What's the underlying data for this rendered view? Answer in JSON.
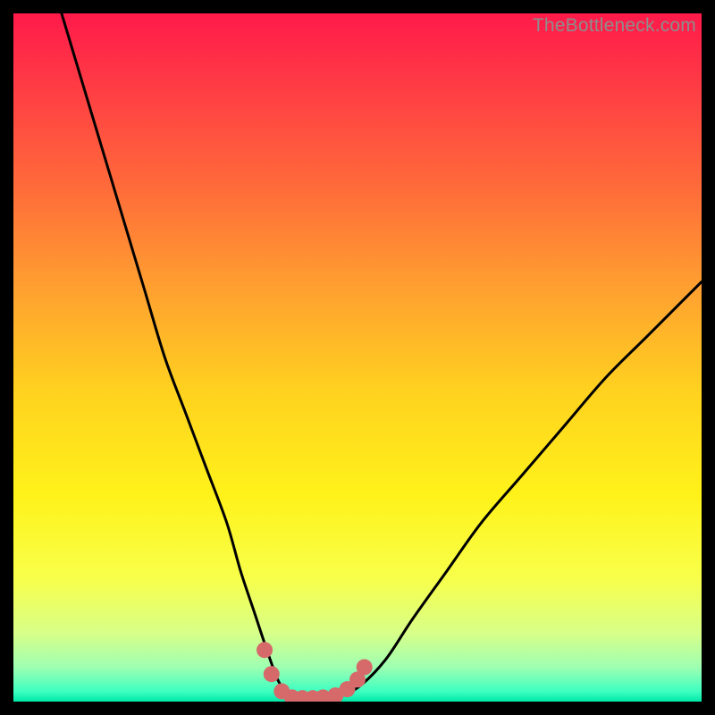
{
  "watermark": {
    "text": "TheBottleneck.com"
  },
  "gradient": {
    "stops": [
      {
        "offset": 0.0,
        "color": "#ff1a4a"
      },
      {
        "offset": 0.1,
        "color": "#ff3a45"
      },
      {
        "offset": 0.25,
        "color": "#ff6a3a"
      },
      {
        "offset": 0.4,
        "color": "#ffa030"
      },
      {
        "offset": 0.55,
        "color": "#ffd21f"
      },
      {
        "offset": 0.7,
        "color": "#fff21a"
      },
      {
        "offset": 0.82,
        "color": "#f8ff4a"
      },
      {
        "offset": 0.9,
        "color": "#d8ff88"
      },
      {
        "offset": 0.95,
        "color": "#9effb2"
      },
      {
        "offset": 0.985,
        "color": "#3effc0"
      },
      {
        "offset": 1.0,
        "color": "#00e8a8"
      }
    ]
  },
  "chart_data": {
    "type": "line",
    "title": "",
    "xlabel": "",
    "ylabel": "",
    "xlim": [
      0,
      100
    ],
    "ylim": [
      0,
      100
    ],
    "series": [
      {
        "name": "bottleneck-curve",
        "x": [
          7,
          10,
          13,
          16,
          19,
          22,
          25,
          28,
          31,
          33,
          35,
          37,
          38.5,
          40,
          41.5,
          43,
          45,
          47,
          50,
          54,
          58,
          63,
          68,
          74,
          80,
          86,
          92,
          100
        ],
        "y": [
          100,
          90,
          80,
          70,
          60,
          50,
          42,
          34,
          26,
          19,
          13,
          7,
          3,
          1,
          0.5,
          0.5,
          0.6,
          0.8,
          2,
          6,
          12,
          19,
          26,
          33,
          40,
          47,
          53,
          61
        ]
      }
    ],
    "bottom_markers": {
      "name": "bottom-dots",
      "color": "#d66a6a",
      "points": [
        {
          "x": 36.5,
          "y": 7.5
        },
        {
          "x": 37.5,
          "y": 4.0
        },
        {
          "x": 39.0,
          "y": 1.5
        },
        {
          "x": 40.5,
          "y": 0.6
        },
        {
          "x": 42.0,
          "y": 0.5
        },
        {
          "x": 43.5,
          "y": 0.5
        },
        {
          "x": 45.0,
          "y": 0.6
        },
        {
          "x": 46.8,
          "y": 0.9
        },
        {
          "x": 48.5,
          "y": 1.8
        },
        {
          "x": 50.0,
          "y": 3.2
        },
        {
          "x": 51.0,
          "y": 5.0
        }
      ]
    }
  }
}
